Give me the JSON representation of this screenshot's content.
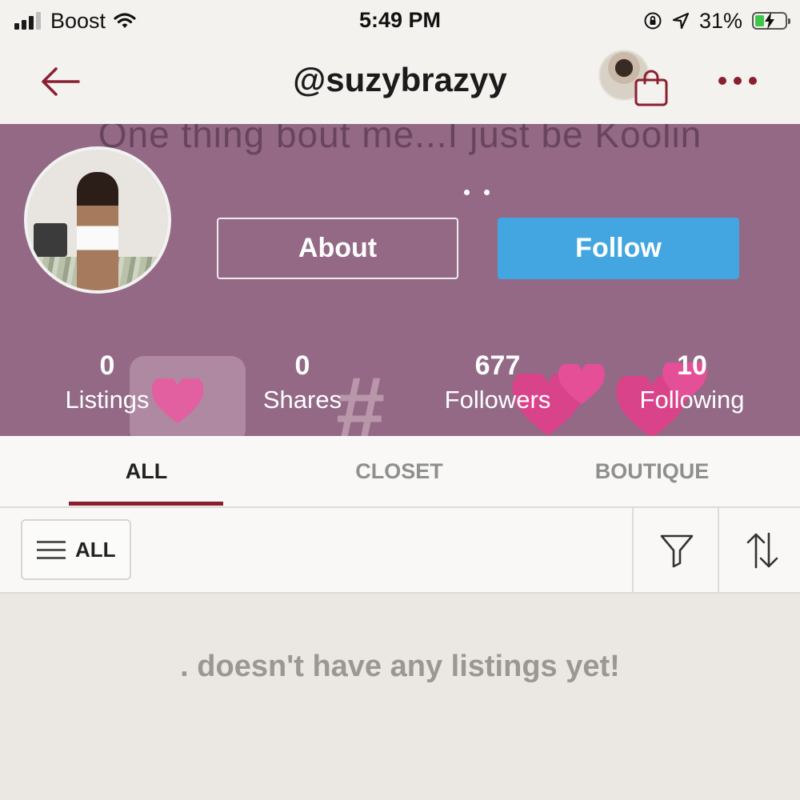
{
  "status_bar": {
    "carrier": "Boost",
    "time": "5:49 PM",
    "battery_percent": "31%",
    "battery_level": 0.31,
    "icons": [
      "cell-signal-icon",
      "wifi-icon",
      "orientation-lock-icon",
      "location-arrow-icon",
      "battery-charging-icon"
    ]
  },
  "nav": {
    "title": "@suzybrazyy",
    "icons": [
      "back-arrow-icon",
      "profile-avatar",
      "shopping-bag-icon",
      "more-dots-icon"
    ]
  },
  "banner": {
    "cover_caption": "One thing bout me...I just be Koolin",
    "about_label": "About",
    "follow_label": "Follow",
    "stats": [
      {
        "value": "0",
        "label": "Listings"
      },
      {
        "value": "0",
        "label": "Shares"
      },
      {
        "value": "677",
        "label": "Followers"
      },
      {
        "value": "10",
        "label": "Following"
      }
    ]
  },
  "tabs": [
    {
      "label": "ALL",
      "active": true
    },
    {
      "label": "CLOSET",
      "active": false
    },
    {
      "label": "BOUTIQUE",
      "active": false
    }
  ],
  "filter_bar": {
    "all_label": "ALL",
    "icons": [
      "menu-icon",
      "filter-funnel-icon",
      "sort-arrows-icon"
    ]
  },
  "empty_state": {
    "message": ". doesn't have any listings yet!"
  },
  "colors": {
    "accent": "#8a1f30",
    "follow_button": "#43a6e0",
    "banner_bg": "#936985"
  }
}
